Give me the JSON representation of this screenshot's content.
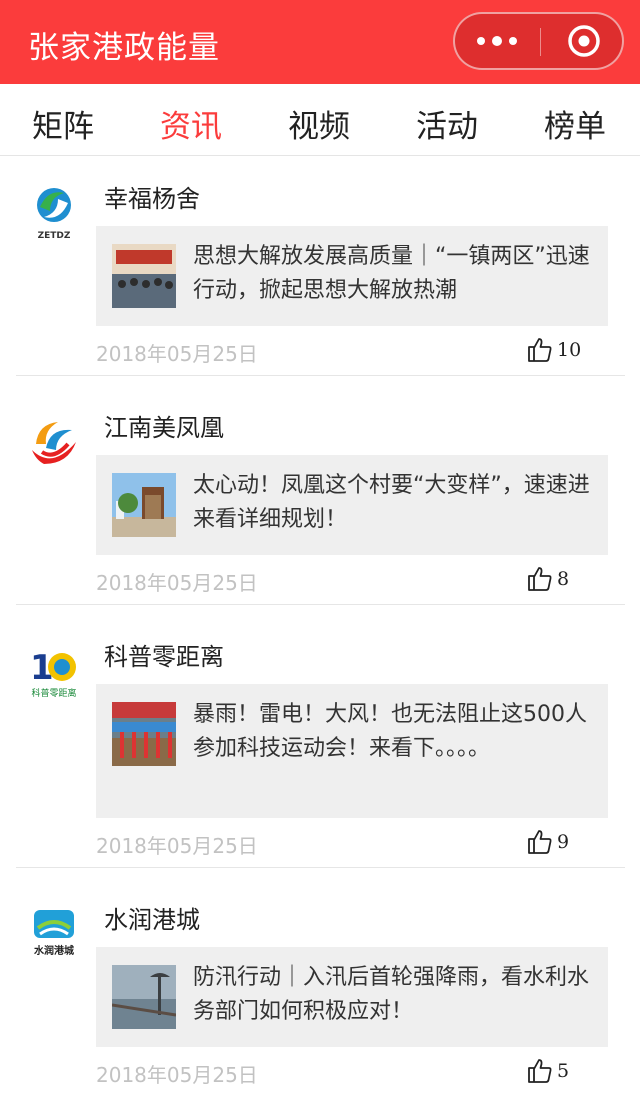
{
  "app": {
    "title": "张家港政能量"
  },
  "tabs": [
    {
      "label": "矩阵"
    },
    {
      "label": "资讯"
    },
    {
      "label": "视频"
    },
    {
      "label": "活动"
    },
    {
      "label": "榜单"
    }
  ],
  "active_tab": "资讯",
  "colors": {
    "brand": "#fb3c3c",
    "card_bg": "#efefef",
    "date": "#c2c2c2"
  },
  "feed": [
    {
      "source": "幸福杨舍",
      "logo_text": "ZETDZ",
      "headline": "思想大解放发展高质量｜“一镇两区”迅速行动，掀起思想大解放热潮",
      "date": "2018年05月25日",
      "likes": "10"
    },
    {
      "source": "江南美凤凰",
      "headline": "太心动！凤凰这个村要“大变样”，速速进来看详细规划！",
      "date": "2018年05月25日",
      "likes": "8"
    },
    {
      "source": "科普零距离",
      "logo_text": "科普零距离",
      "headline": "暴雨！雷电！大风！也无法阻止这500人参加科技运动会！来看下。。。。",
      "date": "2018年05月25日",
      "likes": "9"
    },
    {
      "source": "水润港城",
      "logo_text": "水润港城",
      "headline": "防汛行动｜入汛后首轮强降雨，看水利水务部门如何积极应对！",
      "date": "2018年05月25日",
      "likes": "5"
    }
  ]
}
